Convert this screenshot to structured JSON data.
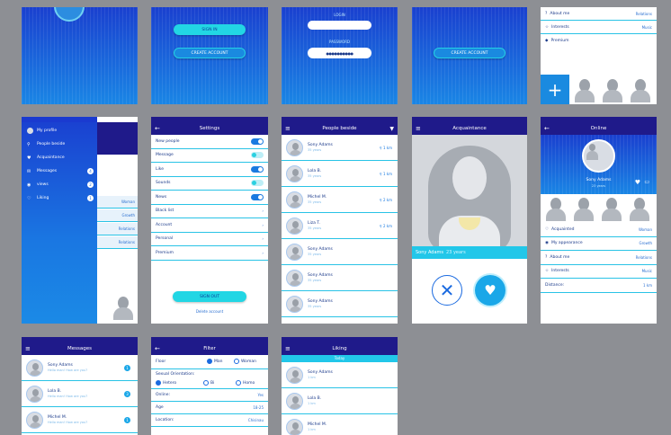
{
  "screen1": {
    "bottom_visible": true
  },
  "screen2": {
    "sign_in": "SIGN IN",
    "create_account": "CREATE ACCOUNT"
  },
  "screen3": {
    "login_label": "LOGIN",
    "password_label": "PASSWORD",
    "password_value": "●●●●●●●●●●"
  },
  "screen4": {
    "create_account": "CREATE ACCOUNT"
  },
  "screen5": {
    "rows": [
      {
        "label": "About me",
        "value": "Relations"
      },
      {
        "label": "Interests",
        "value": "Music"
      },
      {
        "label": "Premium",
        "value": ""
      }
    ],
    "plus": "+"
  },
  "menu": {
    "items": [
      "My profile",
      "People beside",
      "Acquaintance",
      "Messages",
      "views",
      "Liking"
    ],
    "icons": [
      "avatar-icon",
      "pin-icon",
      "heart-icon",
      "message-icon",
      "eye-icon",
      "heart-outline-icon"
    ],
    "badges": [
      "",
      "",
      "",
      "4",
      "2",
      "1"
    ],
    "side_rows": [
      "Woman",
      "Growth",
      "Relations",
      "Relations"
    ]
  },
  "settings": {
    "title": "Settings",
    "toggles": [
      {
        "label": "New people",
        "on": true
      },
      {
        "label": "Message",
        "on": false
      },
      {
        "label": "Like",
        "on": true
      },
      {
        "label": "Sounds",
        "on": false
      },
      {
        "label": "News",
        "on": true
      }
    ],
    "links": [
      "Black list",
      "Account",
      "Personal",
      "Premium"
    ],
    "sign_out": "SIGN OUT",
    "delete": "Delete account"
  },
  "people": {
    "title": "People beside",
    "rows": [
      {
        "name": "Sony Adams",
        "sub": "35 years",
        "dist": "1 km"
      },
      {
        "name": "Lola B.",
        "sub": "35 years",
        "dist": "1 km"
      },
      {
        "name": "Michel M.",
        "sub": "35 years",
        "dist": "2 km"
      },
      {
        "name": "Liza T.",
        "sub": "35 years",
        "dist": "2 km"
      },
      {
        "name": "Sony Adams",
        "sub": "35 years",
        "dist": ""
      },
      {
        "name": "Sony Adams",
        "sub": "35 years",
        "dist": ""
      },
      {
        "name": "Sony Adams",
        "sub": "35 years",
        "dist": ""
      }
    ]
  },
  "acquaintance": {
    "title": "Acquaintance",
    "name": "Sony Adams",
    "age": "23 years"
  },
  "online": {
    "title": "Online",
    "name": "Sony Adams",
    "sub": "23 years",
    "rows": [
      {
        "label": "Acquainted",
        "value": "Woman"
      },
      {
        "label": "My appearance",
        "value": "Growth"
      },
      {
        "label": "About me",
        "value": "Relations"
      },
      {
        "label": "Interests",
        "value": "Music"
      },
      {
        "label": "Distance:",
        "value": "1 km"
      }
    ]
  },
  "messages": {
    "title": "Messages",
    "rows": [
      {
        "name": "Sony Adams",
        "msg": "Hello man! How are you?",
        "badge": "1"
      },
      {
        "name": "Lola B.",
        "msg": "Hello man! How are you?",
        "badge": "3"
      },
      {
        "name": "Michel M.",
        "msg": "Hello man! How are you?",
        "badge": "1"
      }
    ]
  },
  "filter": {
    "title": "Filter",
    "floor_label": "Floor",
    "floor_opts": [
      "Man",
      "Woman"
    ],
    "orient_label": "Sexual Orientation:",
    "orient_opts": [
      "Hetero",
      "Bi",
      "Homo"
    ],
    "rows": [
      {
        "label": "Online:",
        "value": "Yes"
      },
      {
        "label": "Age",
        "value": "18-25"
      },
      {
        "label": "Location:",
        "value": "Chisinau"
      }
    ]
  },
  "liking": {
    "title": "Liking",
    "section": "Today",
    "rows": [
      {
        "name": "Sony Adams",
        "sub": "1 km"
      },
      {
        "name": "Lola B.",
        "sub": "1 km"
      },
      {
        "name": "Michel M.",
        "sub": "1 km"
      }
    ]
  }
}
